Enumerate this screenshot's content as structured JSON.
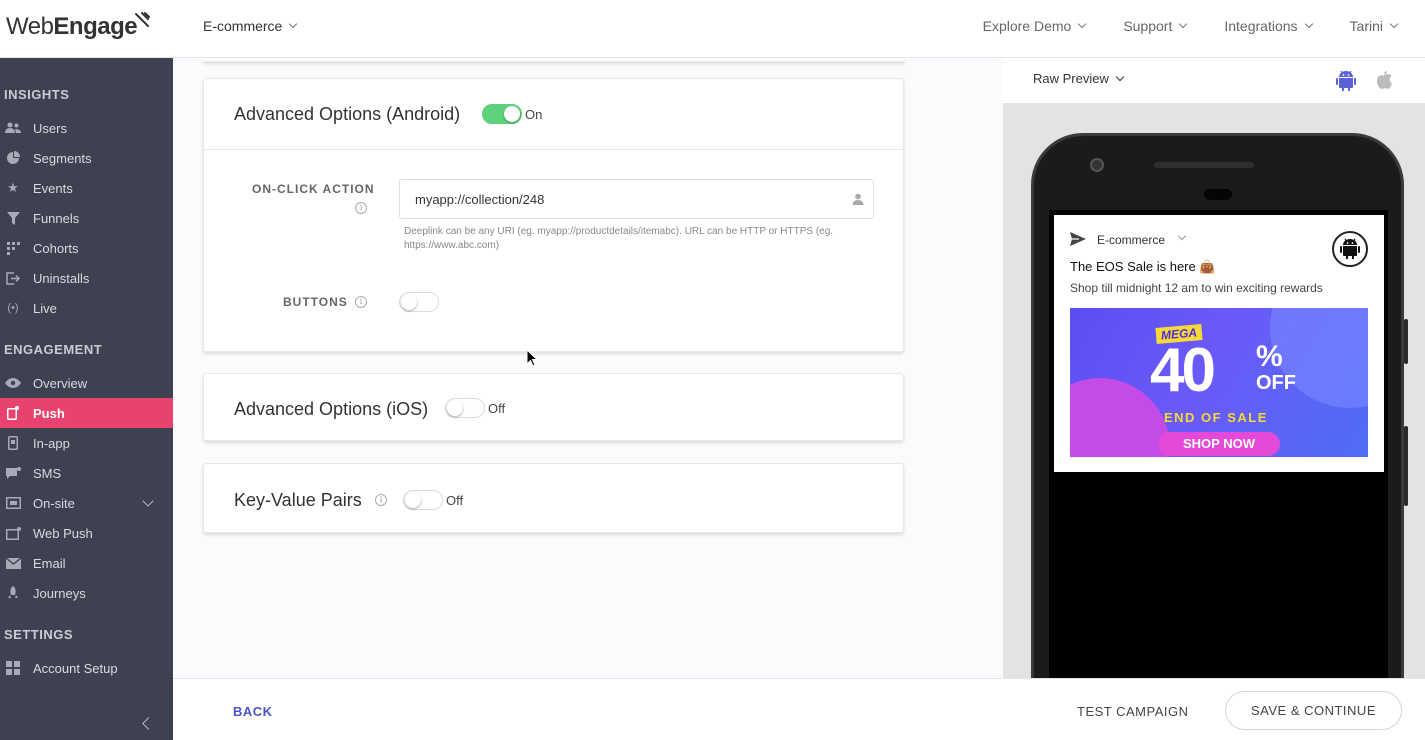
{
  "app": {
    "logo_text_a": "Web",
    "logo_text_b": "Engage"
  },
  "header": {
    "project": "E-commerce",
    "nav": [
      {
        "label": "Explore Demo"
      },
      {
        "label": "Support"
      },
      {
        "label": "Integrations"
      },
      {
        "label": "Tarini"
      }
    ]
  },
  "sidebar": {
    "sections": {
      "insights": "INSIGHTS",
      "engagement": "ENGAGEMENT",
      "settings": "SETTINGS"
    },
    "items": [
      {
        "label": "Users",
        "icon": "users-icon"
      },
      {
        "label": "Segments",
        "icon": "pie-icon"
      },
      {
        "label": "Events",
        "icon": "star-icon"
      },
      {
        "label": "Funnels",
        "icon": "funnel-icon"
      },
      {
        "label": "Cohorts",
        "icon": "grid-icon"
      },
      {
        "label": "Uninstalls",
        "icon": "exit-icon"
      },
      {
        "label": "Live",
        "icon": "broadcast-icon"
      },
      {
        "label": "Overview",
        "icon": "eye-icon"
      },
      {
        "label": "Push",
        "icon": "push-icon",
        "active": true
      },
      {
        "label": "In-app",
        "icon": "phone-icon"
      },
      {
        "label": "SMS",
        "icon": "chat-icon"
      },
      {
        "label": "On-site",
        "icon": "window-icon"
      },
      {
        "label": "Web Push",
        "icon": "web-push-icon"
      },
      {
        "label": "Email",
        "icon": "envelope-icon"
      },
      {
        "label": "Journeys",
        "icon": "rocket-icon"
      },
      {
        "label": "Account Setup",
        "icon": "grid-icon"
      }
    ]
  },
  "android": {
    "title": "Advanced Options (Android)",
    "toggle_state": "On",
    "onclick_label": "ON-CLICK ACTION",
    "onclick_value": "myapp://collection/248",
    "helper": "Deeplink can be any URI (eg. myapp://productdetails/itemabc). URL can be HTTP or HTTPS (eg. https://www.abc.com)",
    "buttons_label": "BUTTONS"
  },
  "ios": {
    "title": "Advanced Options (iOS)",
    "toggle_state": "Off"
  },
  "kv": {
    "title": "Key-Value Pairs",
    "toggle_state": "Off"
  },
  "preview": {
    "mode": "Raw Preview",
    "notification": {
      "app": "E-commerce",
      "title": "The EOS Sale is here 👜",
      "body": "Shop till midnight 12 am to win exciting rewards",
      "banner": {
        "mega": "MEGA",
        "big": "40",
        "pct": "%",
        "off": "OFF",
        "eos": "END OF SALE",
        "cta": "SHOP NOW"
      }
    }
  },
  "footer": {
    "back": "BACK",
    "test": "TEST CAMPAIGN",
    "save": "SAVE & CONTINUE"
  },
  "colors": {
    "sidebar_bg": "#3d4150",
    "active": "#e8436f",
    "toggle_on": "#5dd27a",
    "link": "#4a54c6"
  }
}
